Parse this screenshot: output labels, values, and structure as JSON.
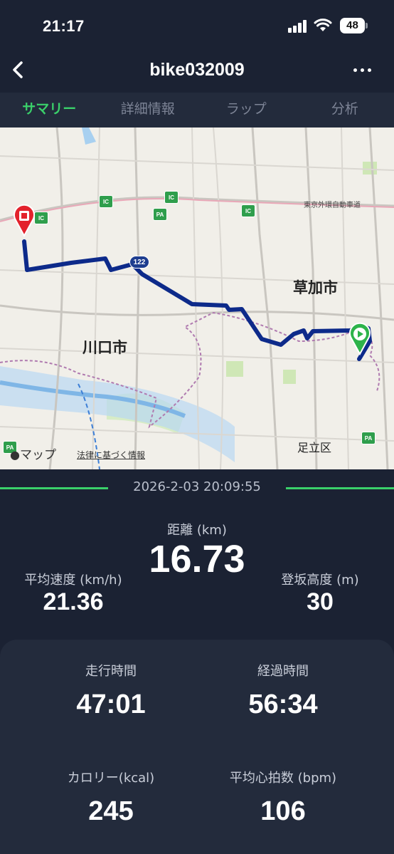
{
  "status_bar": {
    "time": "21:17",
    "battery": "48"
  },
  "nav": {
    "title": "bike032009",
    "back_icon": "chevron-left-icon",
    "more_icon": "ellipsis-icon"
  },
  "tabs": [
    {
      "label": "サマリー",
      "active": true
    },
    {
      "label": "詳細情報",
      "active": false
    },
    {
      "label": "ラップ",
      "active": false
    },
    {
      "label": "分析",
      "active": false
    }
  ],
  "map": {
    "labels": {
      "soka": "草加市",
      "kawaguchi": "川口市",
      "adachi": "足立区",
      "expressway": "東京外環自動車道"
    },
    "ic_label": "IC",
    "pa_label": "PA",
    "route_number": "122",
    "attribution": "マップ",
    "legal": "法律に基づく情報",
    "route_color": "#0d2a8a",
    "start_marker": "play-icon",
    "end_marker": "stop-pin-icon"
  },
  "summary": {
    "date": "2026-2-03 20:09:55",
    "distance_label": "距離 (km)",
    "distance_value": "16.73",
    "avg_speed_label": "平均速度 (km/h)",
    "avg_speed_value": "21.36",
    "climb_label": "登坂高度 (m)",
    "climb_value": "30"
  },
  "details": {
    "moving_time_label": "走行時間",
    "moving_time_value": "47:01",
    "elapsed_time_label": "経過時間",
    "elapsed_time_value": "56:34",
    "calories_label": "カロリー(kcal)",
    "calories_value": "245",
    "avg_hr_label": "平均心拍数 (bpm)",
    "avg_hr_value": "106"
  },
  "colors": {
    "accent": "#3ad06a",
    "background": "#1b2233",
    "card": "#232b3c"
  }
}
